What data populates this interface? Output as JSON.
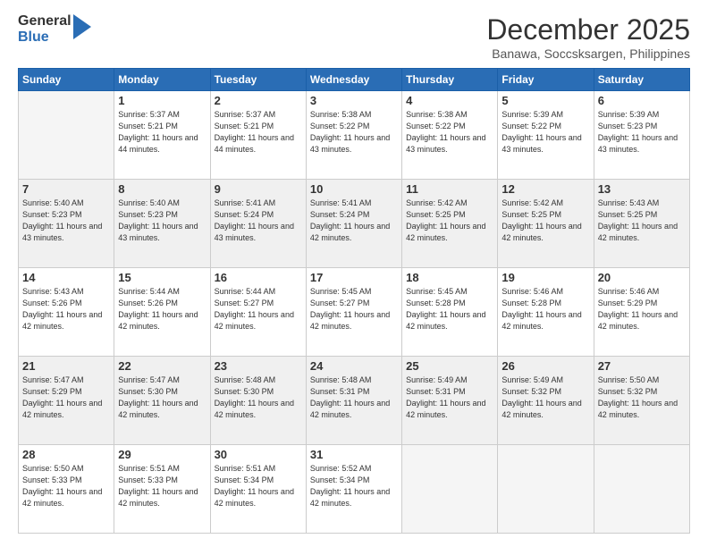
{
  "header": {
    "logo_general": "General",
    "logo_blue": "Blue",
    "month_title": "December 2025",
    "location": "Banawa, Soccsksargen, Philippines"
  },
  "weekdays": [
    "Sunday",
    "Monday",
    "Tuesday",
    "Wednesday",
    "Thursday",
    "Friday",
    "Saturday"
  ],
  "weeks": [
    [
      {
        "day": "",
        "empty": true
      },
      {
        "day": "1",
        "sunrise": "5:37 AM",
        "sunset": "5:21 PM",
        "daylight": "11 hours and 44 minutes."
      },
      {
        "day": "2",
        "sunrise": "5:37 AM",
        "sunset": "5:21 PM",
        "daylight": "11 hours and 44 minutes."
      },
      {
        "day": "3",
        "sunrise": "5:38 AM",
        "sunset": "5:22 PM",
        "daylight": "11 hours and 43 minutes."
      },
      {
        "day": "4",
        "sunrise": "5:38 AM",
        "sunset": "5:22 PM",
        "daylight": "11 hours and 43 minutes."
      },
      {
        "day": "5",
        "sunrise": "5:39 AM",
        "sunset": "5:22 PM",
        "daylight": "11 hours and 43 minutes."
      },
      {
        "day": "6",
        "sunrise": "5:39 AM",
        "sunset": "5:23 PM",
        "daylight": "11 hours and 43 minutes."
      }
    ],
    [
      {
        "day": "7",
        "sunrise": "5:40 AM",
        "sunset": "5:23 PM",
        "daylight": "11 hours and 43 minutes."
      },
      {
        "day": "8",
        "sunrise": "5:40 AM",
        "sunset": "5:23 PM",
        "daylight": "11 hours and 43 minutes."
      },
      {
        "day": "9",
        "sunrise": "5:41 AM",
        "sunset": "5:24 PM",
        "daylight": "11 hours and 43 minutes."
      },
      {
        "day": "10",
        "sunrise": "5:41 AM",
        "sunset": "5:24 PM",
        "daylight": "11 hours and 42 minutes."
      },
      {
        "day": "11",
        "sunrise": "5:42 AM",
        "sunset": "5:25 PM",
        "daylight": "11 hours and 42 minutes."
      },
      {
        "day": "12",
        "sunrise": "5:42 AM",
        "sunset": "5:25 PM",
        "daylight": "11 hours and 42 minutes."
      },
      {
        "day": "13",
        "sunrise": "5:43 AM",
        "sunset": "5:25 PM",
        "daylight": "11 hours and 42 minutes."
      }
    ],
    [
      {
        "day": "14",
        "sunrise": "5:43 AM",
        "sunset": "5:26 PM",
        "daylight": "11 hours and 42 minutes."
      },
      {
        "day": "15",
        "sunrise": "5:44 AM",
        "sunset": "5:26 PM",
        "daylight": "11 hours and 42 minutes."
      },
      {
        "day": "16",
        "sunrise": "5:44 AM",
        "sunset": "5:27 PM",
        "daylight": "11 hours and 42 minutes."
      },
      {
        "day": "17",
        "sunrise": "5:45 AM",
        "sunset": "5:27 PM",
        "daylight": "11 hours and 42 minutes."
      },
      {
        "day": "18",
        "sunrise": "5:45 AM",
        "sunset": "5:28 PM",
        "daylight": "11 hours and 42 minutes."
      },
      {
        "day": "19",
        "sunrise": "5:46 AM",
        "sunset": "5:28 PM",
        "daylight": "11 hours and 42 minutes."
      },
      {
        "day": "20",
        "sunrise": "5:46 AM",
        "sunset": "5:29 PM",
        "daylight": "11 hours and 42 minutes."
      }
    ],
    [
      {
        "day": "21",
        "sunrise": "5:47 AM",
        "sunset": "5:29 PM",
        "daylight": "11 hours and 42 minutes."
      },
      {
        "day": "22",
        "sunrise": "5:47 AM",
        "sunset": "5:30 PM",
        "daylight": "11 hours and 42 minutes."
      },
      {
        "day": "23",
        "sunrise": "5:48 AM",
        "sunset": "5:30 PM",
        "daylight": "11 hours and 42 minutes."
      },
      {
        "day": "24",
        "sunrise": "5:48 AM",
        "sunset": "5:31 PM",
        "daylight": "11 hours and 42 minutes."
      },
      {
        "day": "25",
        "sunrise": "5:49 AM",
        "sunset": "5:31 PM",
        "daylight": "11 hours and 42 minutes."
      },
      {
        "day": "26",
        "sunrise": "5:49 AM",
        "sunset": "5:32 PM",
        "daylight": "11 hours and 42 minutes."
      },
      {
        "day": "27",
        "sunrise": "5:50 AM",
        "sunset": "5:32 PM",
        "daylight": "11 hours and 42 minutes."
      }
    ],
    [
      {
        "day": "28",
        "sunrise": "5:50 AM",
        "sunset": "5:33 PM",
        "daylight": "11 hours and 42 minutes."
      },
      {
        "day": "29",
        "sunrise": "5:51 AM",
        "sunset": "5:33 PM",
        "daylight": "11 hours and 42 minutes."
      },
      {
        "day": "30",
        "sunrise": "5:51 AM",
        "sunset": "5:34 PM",
        "daylight": "11 hours and 42 minutes."
      },
      {
        "day": "31",
        "sunrise": "5:52 AM",
        "sunset": "5:34 PM",
        "daylight": "11 hours and 42 minutes."
      },
      {
        "day": "",
        "empty": true
      },
      {
        "day": "",
        "empty": true
      },
      {
        "day": "",
        "empty": true
      }
    ]
  ],
  "labels": {
    "sunrise": "Sunrise:",
    "sunset": "Sunset:",
    "daylight": "Daylight:"
  }
}
